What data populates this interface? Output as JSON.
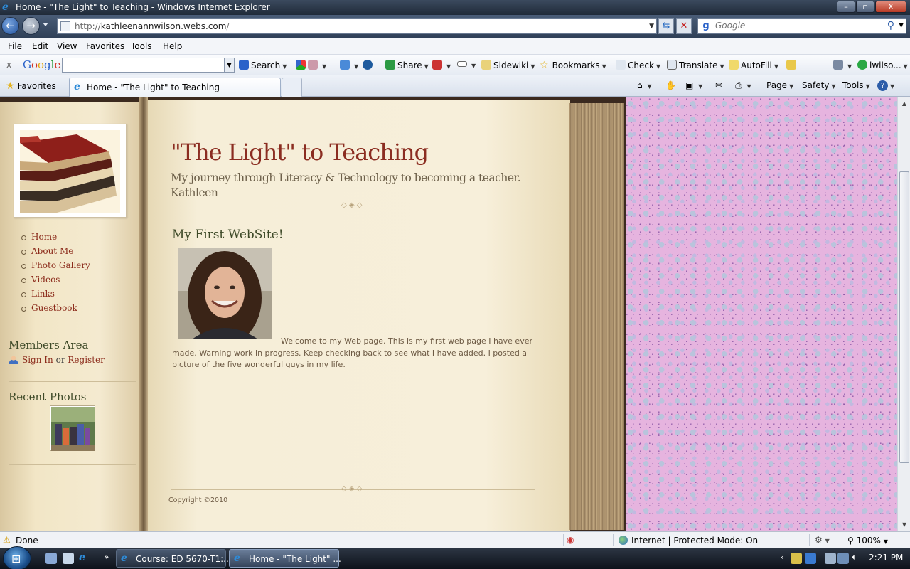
{
  "window": {
    "title": "Home - \"The Light\" to Teaching - Windows Internet Explorer",
    "buttons": [
      "–",
      "▫",
      "X"
    ]
  },
  "address_bar": {
    "url_prefix": "http://",
    "url_domain": "kathleenannwilson.webs.com",
    "url_suffix": "/",
    "search_placeholder": "Google"
  },
  "menu": [
    "File",
    "Edit",
    "View",
    "Favorites",
    "Tools",
    "Help"
  ],
  "google_toolbar": {
    "logo": "Google",
    "items": [
      "Search",
      "Share",
      "Sidewiki",
      "Bookmarks",
      "Check",
      "Translate",
      "AutoFill",
      "lwilso..."
    ]
  },
  "tab_bar": {
    "favorites_label": "Favorites",
    "active_tab_title": "Home - \"The Light\" to Teaching",
    "commands": [
      "Page",
      "Safety",
      "Tools"
    ]
  },
  "site": {
    "title": "\"The Light\" to Teaching",
    "subtitle": "My journey through Literacy & Technology to becoming a teacher. Kathleen",
    "nav": [
      "Home",
      "About Me",
      "Photo Gallery",
      "Videos",
      "Links",
      "Guestbook"
    ],
    "members_heading": "Members Area",
    "sign_in": "Sign In",
    "or": "or",
    "register": "Register",
    "recent_photos_heading": "Recent Photos",
    "content_heading": "My First WebSite!",
    "body_text": "Welcome to my Web page.  This is my first web page I have ever made.  Warning work in progress.  Keep checking back to see what I have added.  I posted a picture of  the five wonderful guys in my life.",
    "copyright": "Copyright ©2010"
  },
  "status_bar": {
    "status": "Done",
    "zone": "Internet | Protected Mode: On",
    "zoom": "100%"
  },
  "taskbar": {
    "buttons": [
      "Course: ED 5670-T1:...",
      "Home - \"The Light\" ..."
    ],
    "clock": "2:21 PM"
  }
}
